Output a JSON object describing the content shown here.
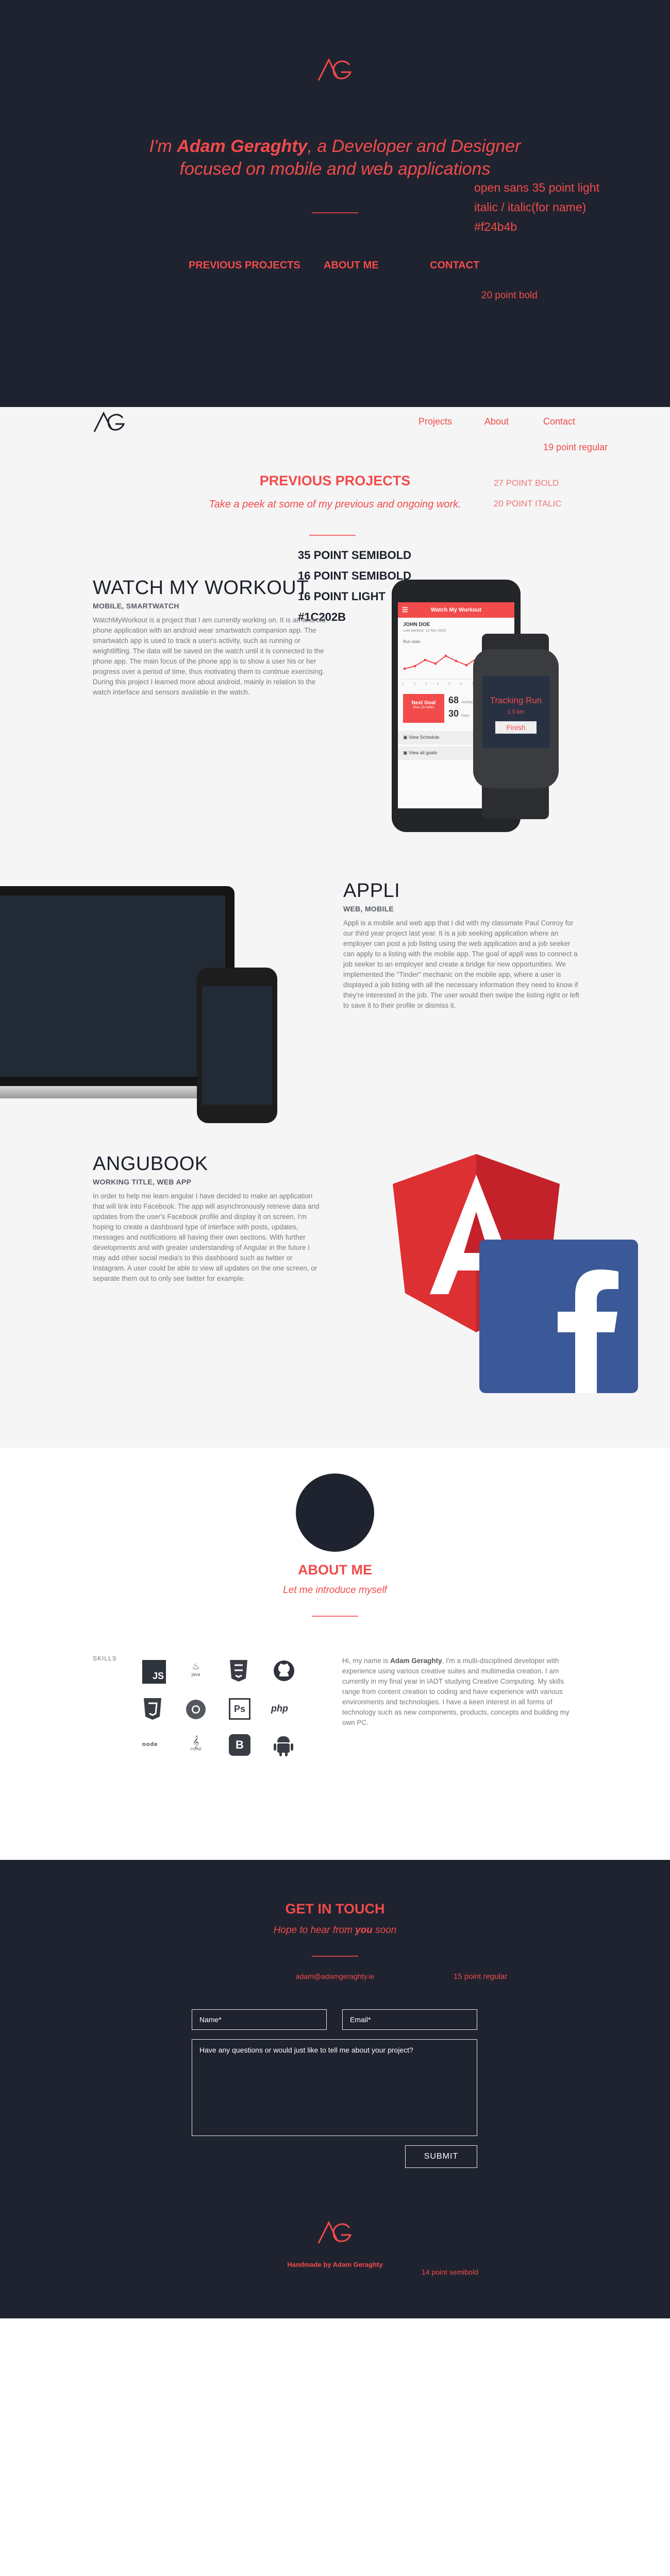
{
  "colors": {
    "dark_bg": "#1f232f",
    "light_bg": "#f5f5f5",
    "accent": "#f24b4b",
    "text_dark": "#1C202B"
  },
  "hero": {
    "intro_prefix": "I'm ",
    "intro_name": "Adam Geraghty",
    "intro_rest": ", a Developer and Designer",
    "intro_line2": "focused on mobile and web applications",
    "annotation_font": [
      "open sans 35 point light",
      "italic / italic(for name)",
      "#f24b4b"
    ],
    "nav": [
      "PREVIOUS PROJECTS",
      "ABOUT ME",
      "CONTACT"
    ],
    "nav_annotation": "20 point bold"
  },
  "topbar": {
    "nav": [
      "Projects",
      "About",
      "Contact"
    ],
    "annotation": "19 point regular"
  },
  "projects_section": {
    "title": "PREVIOUS PROJECTS",
    "subtitle": "Take a peek at some of my previous and ongoing work.",
    "annotation_title": "27 POINT BOLD",
    "annotation_subtitle": "20 POINT ITALIC",
    "type_annotation": [
      "35 POINT SEMIBOLD",
      "16 POINT SEMIBOLD",
      "16 POINT LIGHT",
      "#1C202B"
    ]
  },
  "projects": [
    {
      "title": "WATCH MY WORKOUT",
      "tags": "MOBILE, SMARTWATCH",
      "desc": "WatchMyWorkout is a project that I am currently working on. It is an android phone application with an android wear smartwatch companion app. The smartwatch app is used to track a user's activity, such as running or weightlifting. The data will be saved on the watch until it is connected to the phone app. The main focus of the phone app is to show a user his or her progress over a period of time, thus motivating them to continue exercising. During this project I learned more about android, mainly in relation to the watch interface and sensors available in the watch."
    },
    {
      "title": "APPLI",
      "tags": "WEB, MOBILE",
      "desc": "Appli is a mobile and web app that I did with my classmate Paul Conroy for our third year project last year. It is a job seeking application where an employer can post a job listing using the web application and a job seeker can apply to a listing with the mobile app. The goal of appli was to connect a job seeker to an employer and create a bridge for new opportunities. We implemented the \"Tinder\" mechanic on the mobile app, where a user is displayed a job listing with all the necessary information they need to know if they're interested in the job. The user would then swipe the listing right or left to save it to their profile or dismiss it."
    },
    {
      "title": "ANGUBOOK",
      "tags": "WORKING TITLE, WEB APP",
      "desc": "In order to help me learn angular I have decided to make an application that will link into Facebook. The app will asynchronously retrieve data and updates from the user's Facebook profile and display it on screen, I'm hoping to create a dashboard type of interface with posts, updates, messages and notifications all having their own sections. With further developments and with greater understanding of Angular in the future I may add other social media's to this dashboard such as twitter or Instagram. A user could be able to view all updates on the one screen, or separate them out to only see twitter for example."
    }
  ],
  "phone_app": {
    "app_title": "Watch My Workout",
    "user": "JOHN DOE",
    "user_sub": "Last workout: 12 Nov 2015",
    "chart_label": "Run stats",
    "axis_days": [
      "1",
      "2",
      "3",
      "4",
      "5",
      "6",
      "7",
      "8",
      "9",
      "10"
    ],
    "next_goal": "Next Goal",
    "next_goal_sub": "Run 10 miles",
    "stat1_num": "68",
    "stat1_lbl": "Activity",
    "stat2_num": "30",
    "stat2_lbl": "Days",
    "row1": "View Schedule",
    "row2": "View all goals"
  },
  "watch": {
    "title": "Tracking Run",
    "distance": "1.5 km",
    "button": "Finish"
  },
  "about": {
    "title": "ABOUT ME",
    "subtitle": "Let me introduce myself",
    "skills_label": "SKILLS",
    "skills": [
      "JS",
      "java",
      "HTML5",
      "github",
      "CSS3",
      "chrome",
      "Ps",
      "php",
      "node",
      "mysql",
      "B",
      "android"
    ],
    "bio_prefix": "Hi, my name is ",
    "bio_name": "Adam Geraghty",
    "bio_rest": ", I'm a multi-disciplined developer with experience using various creative suites and multimedia creation. I am currently in my final year in IADT studying Creative Computing. My skills range from content creation to coding and have experience with various environments and technologies. I have a keen interest in all forms of technology such as new components, products, concepts and building my own PC."
  },
  "contact": {
    "title": "GET IN TOUCH",
    "subtitle_prefix": "Hope to hear from ",
    "subtitle_bold": "you",
    "subtitle_suffix": " soon",
    "email": "adam@adamgeraghty.ie",
    "email_annotation": "15 point regular",
    "name_placeholder": "Name*",
    "email_placeholder": "Email*",
    "message_placeholder": "Have any questions or would just like to tell me about your project?",
    "submit": "SUBMIT"
  },
  "footer": {
    "credit": "Handmade by Adam Geraghty",
    "annotation": "14 point semibold"
  }
}
